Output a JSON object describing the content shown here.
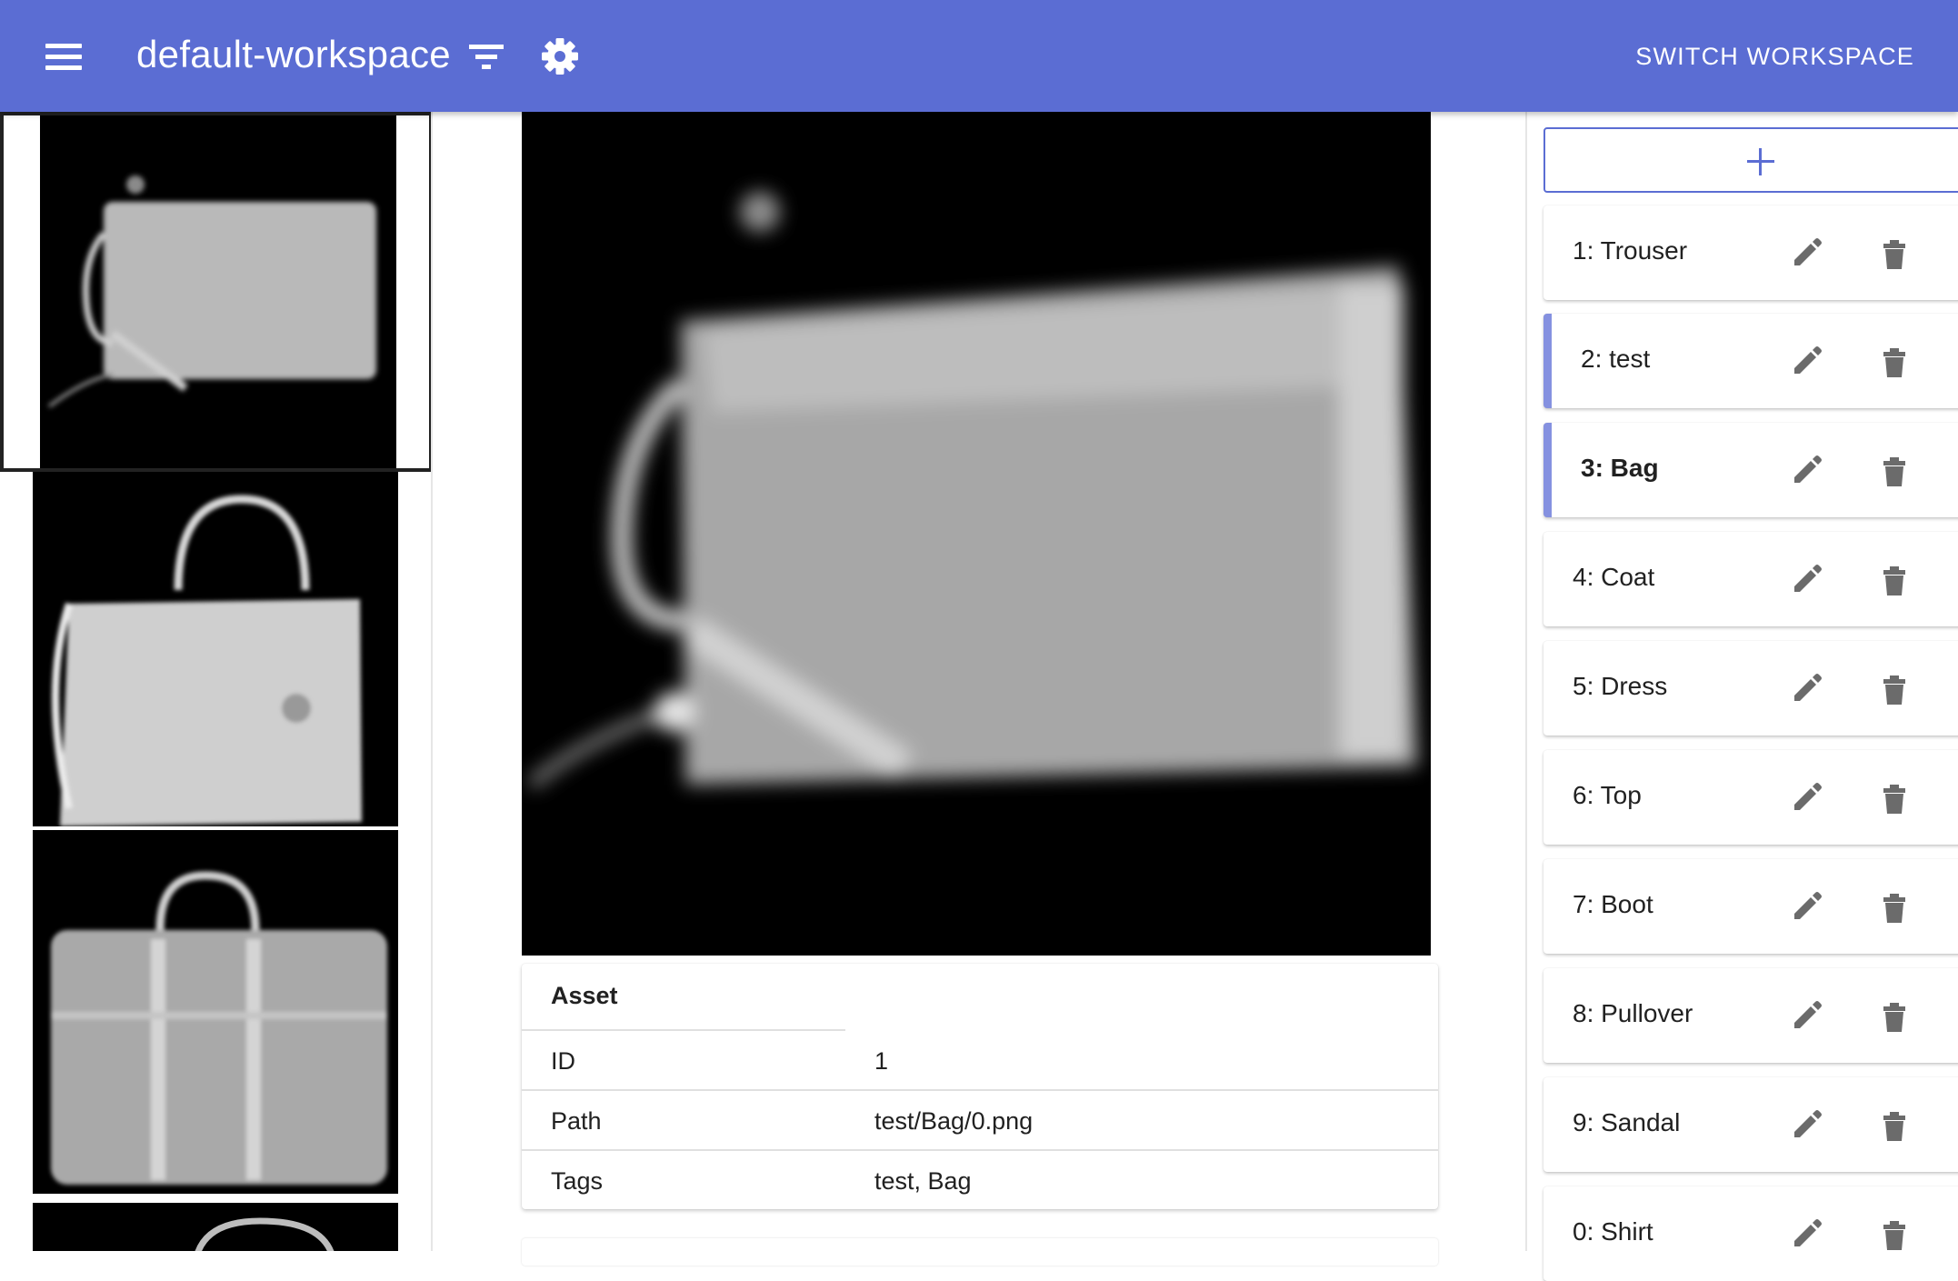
{
  "appbar": {
    "title": "default-workspace",
    "switch_label": "SWITCH WORKSPACE",
    "color": "#5b6dd3",
    "icons": [
      "menu-icon",
      "filter-icon",
      "settings-icon"
    ]
  },
  "details": {
    "heading": "Asset",
    "rows": [
      {
        "key": "ID",
        "value": "1"
      },
      {
        "key": "Path",
        "value": "test/Bag/0.png"
      },
      {
        "key": "Tags",
        "value": "test, Bag"
      }
    ]
  },
  "labels": {
    "add_icon": "plus-icon",
    "items": [
      {
        "label": "1: Trouser"
      },
      {
        "label": "2: test"
      },
      {
        "label": "3: Bag"
      },
      {
        "label": "4: Coat"
      },
      {
        "label": "5: Dress"
      },
      {
        "label": "6: Top"
      },
      {
        "label": "7: Boot"
      },
      {
        "label": "8: Pullover"
      },
      {
        "label": "9: Sandal"
      },
      {
        "label": "0: Shirt"
      }
    ],
    "accent_color": "#8591e0",
    "item_icons": [
      "pencil-icon",
      "trash-icon"
    ]
  }
}
